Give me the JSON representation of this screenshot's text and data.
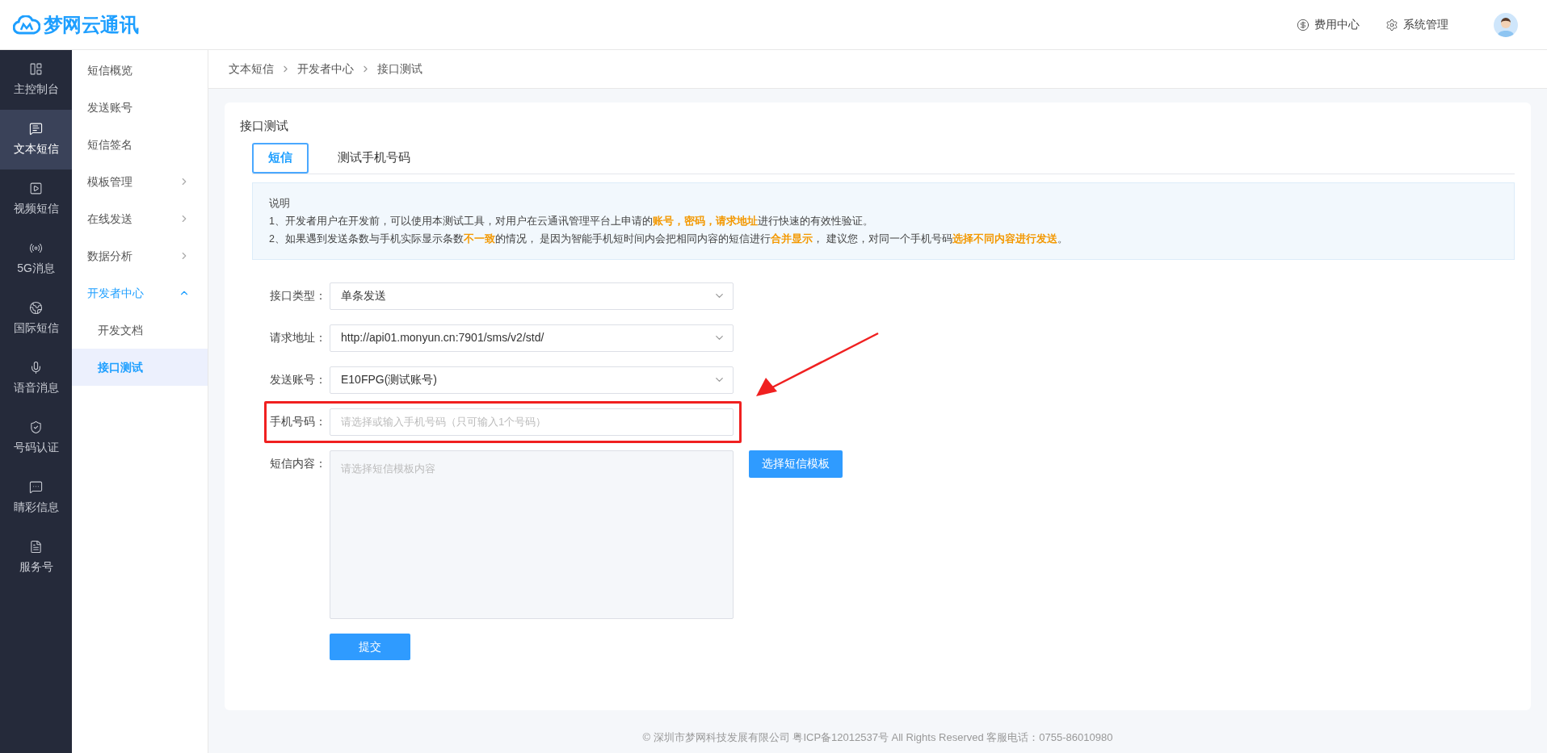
{
  "header": {
    "logo": "梦网云通讯",
    "links": [
      {
        "kind": "fee",
        "label": "费用中心"
      },
      {
        "kind": "settings",
        "label": "系统管理"
      }
    ]
  },
  "main_nav": [
    {
      "label": "主控制台",
      "selected": false
    },
    {
      "label": "文本短信",
      "selected": true
    },
    {
      "label": "视频短信",
      "selected": false
    },
    {
      "label": "5G消息",
      "selected": false
    },
    {
      "label": "国际短信",
      "selected": false
    },
    {
      "label": "语音消息",
      "selected": false
    },
    {
      "label": "号码认证",
      "selected": false
    },
    {
      "label": "睛彩信息",
      "selected": false
    },
    {
      "label": "服务号",
      "selected": false
    }
  ],
  "sub_nav": [
    {
      "label": "短信概览",
      "selected": false
    },
    {
      "label": "发送账号",
      "selected": false
    },
    {
      "label": "短信签名",
      "selected": false
    },
    {
      "label": "模板管理",
      "selected": false,
      "expanded": false
    },
    {
      "label": "在线发送",
      "selected": false,
      "expanded": false
    },
    {
      "label": "数据分析",
      "selected": false,
      "expanded": false
    },
    {
      "label": "开发者中心",
      "selected": false,
      "expanded": true,
      "children": [
        {
          "label": "开发文档",
          "selected": false
        },
        {
          "label": "接口测试",
          "selected": true
        }
      ]
    }
  ],
  "breadcrumb": [
    "文本短信",
    "开发者中心",
    "接口测试"
  ],
  "card": {
    "title": "接口测试",
    "tabs": [
      {
        "label": "短信",
        "selected": true
      },
      {
        "label": "测试手机号码",
        "selected": false
      }
    ],
    "notice": {
      "title": "说明",
      "lines": [
        "1、开发者用户在开发前，可以使用本测试工具，对用户在云通讯管理平台上申请的**账号，密码，请求地址**进行快速的有效性验证。",
        "2、如果遇到发送条数与手机实际显示条数**不一致**的情况， 是因为智能手机短时间内会把相同内容的短信进行**合并显示**， 建议您，对同一个手机号码**选择不同内容进行发送**。"
      ]
    },
    "form": [
      {
        "kind": "select",
        "label": "接口类型：",
        "value": "单条发送",
        "highlighted": false
      },
      {
        "kind": "select",
        "label": "请求地址：",
        "value": "http://api01.monyun.cn:7901/sms/v2/std/",
        "highlighted": false
      },
      {
        "kind": "select",
        "label": "发送账号：",
        "value": "E10FPG(测试账号)",
        "highlighted": false
      },
      {
        "kind": "input",
        "label": "手机号码：",
        "placeholder": "请选择或输入手机号码（只可输入1个号码）",
        "highlighted": true
      },
      {
        "kind": "textarea",
        "label": "短信内容：",
        "placeholder": "请选择短信模板内容",
        "button": "选择短信模板",
        "highlighted": false
      }
    ],
    "submit": "提交"
  },
  "footer": "© 深圳市梦网科技发展有限公司 粤ICP备12012537号 All Rights Reserved 客服电话：0755-86010980"
}
